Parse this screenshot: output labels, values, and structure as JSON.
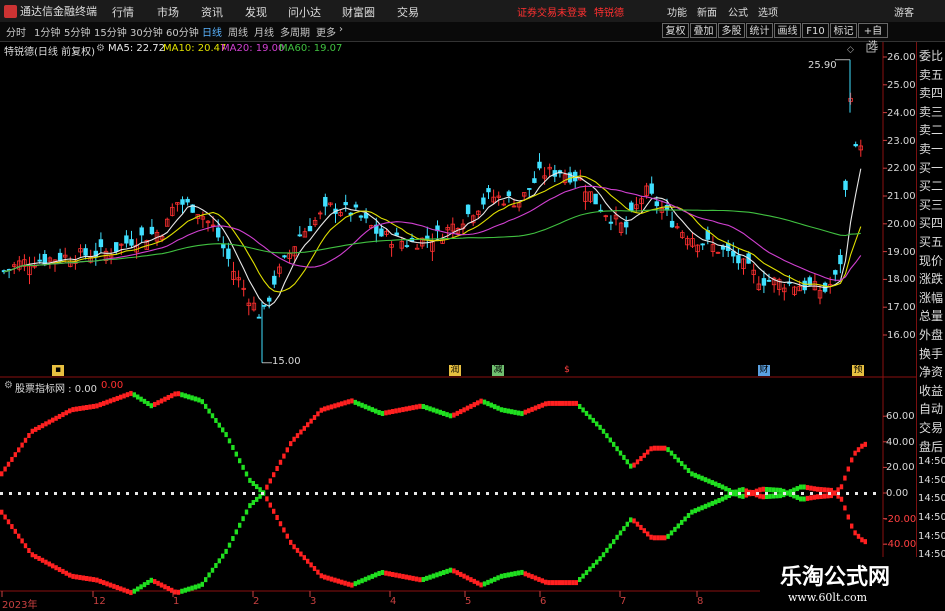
{
  "app": {
    "title": "通达信金融终端"
  },
  "menu": [
    "行情",
    "市场",
    "资讯",
    "发现",
    "问小达",
    "财富圈",
    "交易"
  ],
  "notice": {
    "text": "证券交易未登录",
    "stock": "特锐德"
  },
  "right_menu": [
    "功能",
    "新面",
    "公式",
    "选项",
    "游客"
  ],
  "periods": [
    "分时",
    "1分钟",
    "5分钟",
    "15分钟",
    "30分钟",
    "60分钟",
    "日线",
    "周线",
    "月线",
    "多周期",
    "更多"
  ],
  "active_period": "日线",
  "toolbar": [
    "复权",
    "叠加",
    "多股",
    "统计",
    "画线",
    "F10",
    "标记",
    "+自选"
  ],
  "legend": {
    "stock_label": "特锐德(日线 前复权)",
    "ma5": "MA5: 22.72",
    "ma10": "MA10: 20.47",
    "ma20": "MA20: 19.00",
    "ma60": "MA60: 19.07"
  },
  "indicator": {
    "label": "股票指标网 : 0.00",
    "value": "0.00"
  },
  "side_panel": [
    "委比",
    "卖五",
    "卖四",
    "卖三",
    "卖二",
    "卖一",
    "买一",
    "买二",
    "买三",
    "买四",
    "买五",
    "现价",
    "涨跌",
    "涨幅",
    "总量",
    "外盘",
    "换手",
    "净资",
    "收益",
    "自动",
    "交易",
    "盘后",
    "14:50",
    "14:50",
    "14:50",
    "14:50",
    "14:50",
    "14:50",
    "14:50"
  ],
  "colors": {
    "up": "#ff2020",
    "down": "#20e020",
    "ma5": "#e8e8e8",
    "ma10": "#e0e000",
    "ma20": "#d040d0",
    "ma60": "#40c040"
  },
  "price_axis": [
    "26.00",
    "25.00",
    "24.00",
    "23.00",
    "22.00",
    "21.00",
    "20.00",
    "19.00",
    "18.00",
    "17.00",
    "16.00"
  ],
  "price_annotations": {
    "high": "25.90",
    "low": "15.00"
  },
  "indicator_axis": [
    "60.00",
    "40.00",
    "20.00",
    "0.00",
    "-20.00",
    "-40.00"
  ],
  "x_axis": [
    "2023年",
    "12",
    "1",
    "2",
    "3",
    "4",
    "5",
    "6",
    "7",
    "8"
  ],
  "event_markers": [
    "润",
    "减",
    "$",
    "财",
    "预"
  ],
  "watermark": {
    "text": "乐淘公式网",
    "url": "www.60lt.com"
  }
}
